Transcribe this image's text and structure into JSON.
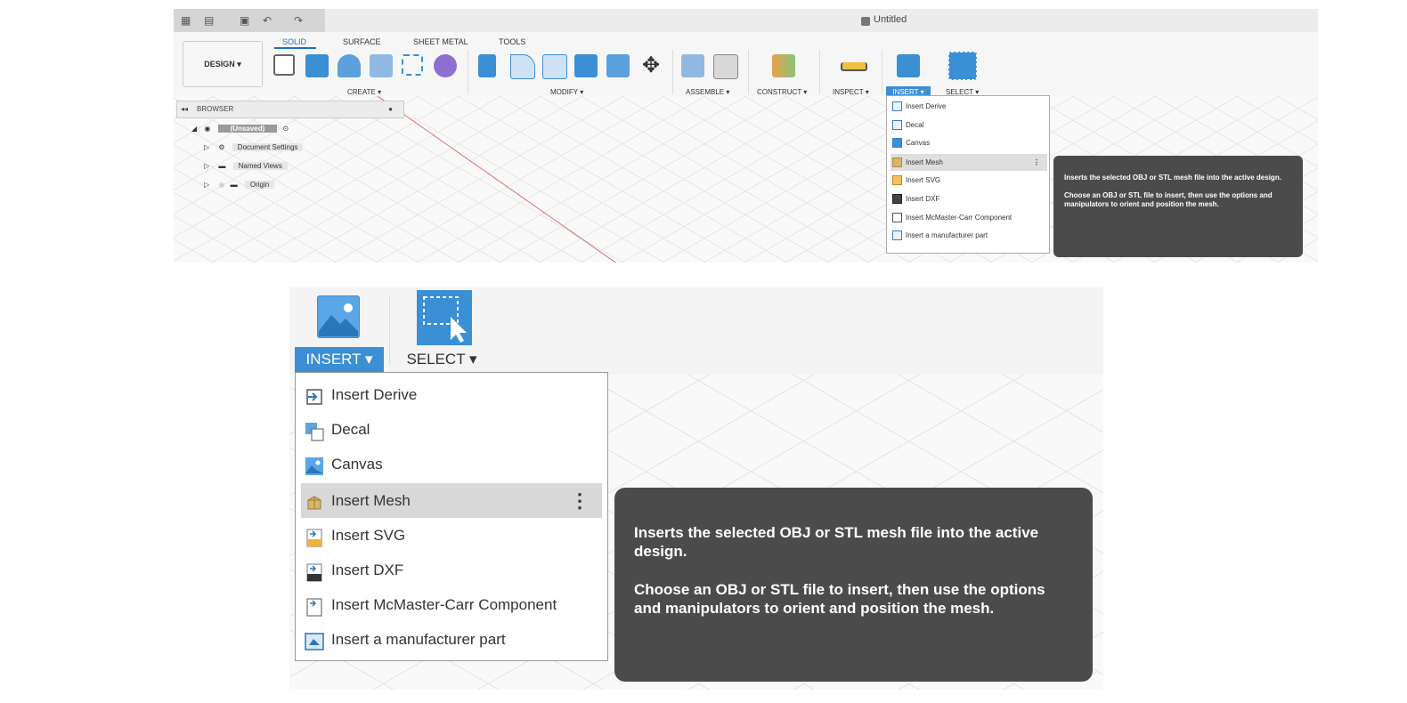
{
  "app": {
    "document_title": "Untitled",
    "mode_button": "DESIGN ▾"
  },
  "tabs": [
    "SOLID",
    "SURFACE",
    "SHEET METAL",
    "TOOLS"
  ],
  "groups": {
    "create": "CREATE ▾",
    "modify": "MODIFY ▾",
    "assemble": "ASSEMBLE ▾",
    "construct": "CONSTRUCT ▾",
    "inspect": "INSPECT ▾",
    "insert": "INSERT ▾",
    "select": "SELECT ▾"
  },
  "browser": {
    "title": "BROWSER",
    "root": "(Unsaved)",
    "items": [
      "Document Settings",
      "Named Views",
      "Origin"
    ]
  },
  "insert_menu": {
    "items": [
      {
        "label": "Insert Derive",
        "icon": "insert-derive-icon"
      },
      {
        "label": "Decal",
        "icon": "decal-icon"
      },
      {
        "label": "Canvas",
        "icon": "canvas-icon"
      },
      {
        "label": "Insert Mesh",
        "icon": "mesh-icon",
        "highlighted": true
      },
      {
        "label": "Insert SVG",
        "icon": "svg-icon"
      },
      {
        "label": "Insert DXF",
        "icon": "dxf-icon"
      },
      {
        "label": "Insert McMaster-Carr Component",
        "icon": "mcmaster-icon"
      },
      {
        "label": "Insert a manufacturer part",
        "icon": "manufacturer-part-icon"
      }
    ],
    "more_glyph": "⋮"
  },
  "tooltip": {
    "line1": "Inserts the selected OBJ or STL mesh file into the active design.",
    "line2": "Choose an OBJ or STL file to insert, then use the options and manipulators to orient and position the mesh."
  },
  "zoom": {
    "insert_tab": "INSERT ▾",
    "select_tab": "SELECT ▾"
  },
  "colors": {
    "accent": "#3b8fd4",
    "tooltip_bg": "#4b4b4b",
    "highlight": "#d8d8d8"
  }
}
